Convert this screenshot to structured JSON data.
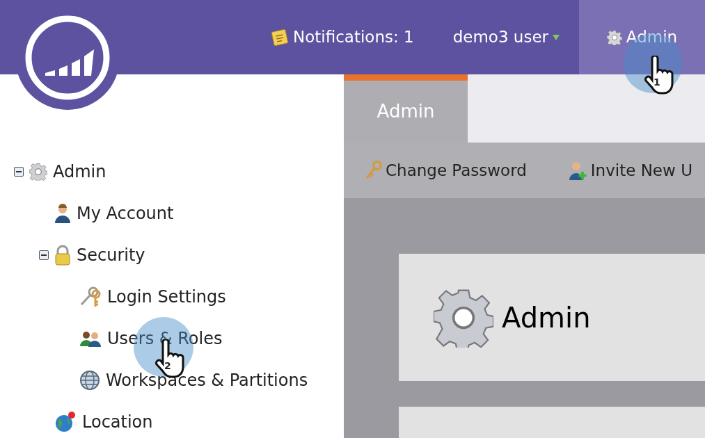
{
  "nav": [
    {
      "kind": "notifications",
      "label": "Notifications: 1",
      "selected": false
    },
    {
      "kind": "user",
      "label": "demo3 user",
      "selected": false
    },
    {
      "kind": "admin",
      "label": "Admin",
      "selected": true
    }
  ],
  "tree": [
    {
      "kind": "gear",
      "label": "Admin",
      "expanded": true,
      "children": [
        {
          "kind": "person",
          "label": "My Account"
        },
        {
          "kind": "lock",
          "label": "Security",
          "expanded": true,
          "children": [
            {
              "kind": "keys",
              "label": "Login Settings"
            },
            {
              "kind": "users",
              "label": "Users & Roles"
            },
            {
              "kind": "globe",
              "label": "Workspaces & Partitions"
            }
          ]
        },
        {
          "kind": "location",
          "label": "Location"
        }
      ]
    }
  ],
  "tabs": [
    {
      "label": "Admin",
      "selected": true
    }
  ],
  "toolbar": [
    {
      "kind": "key",
      "label": "Change Password"
    },
    {
      "kind": "invite",
      "label": "Invite New U"
    }
  ],
  "panel": {
    "title": "Admin"
  },
  "callouts": [
    {
      "number": "1"
    },
    {
      "number": "2"
    }
  ]
}
